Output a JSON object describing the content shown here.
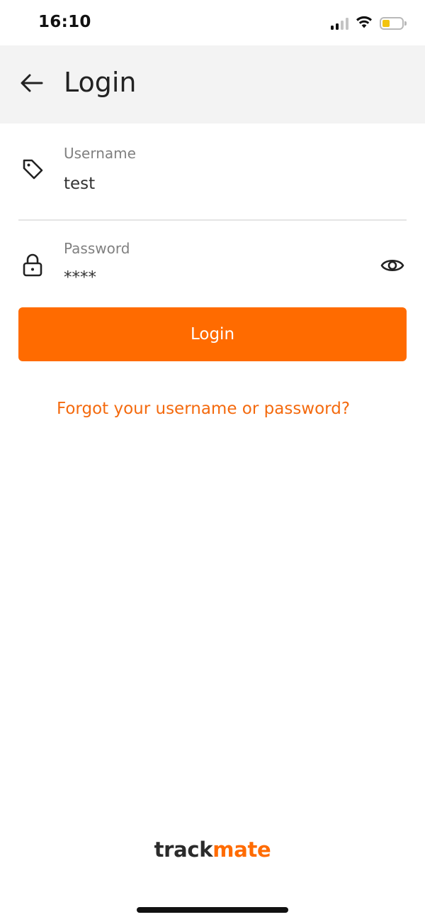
{
  "status_bar": {
    "time": "16:10",
    "signal_bars": 4,
    "signal_active_bars": 2,
    "battery_level": 0.2,
    "battery_color": "#f2c40f"
  },
  "header": {
    "title": "Login",
    "back_icon": "arrow-left-icon",
    "background": "#f3f3f3"
  },
  "form": {
    "username": {
      "label": "Username",
      "value": "test",
      "icon": "tag-icon"
    },
    "password": {
      "label": "Password",
      "value": "****",
      "icon": "lock-icon",
      "toggle_icon": "eye-icon"
    },
    "submit_label": "Login",
    "forgot_link": "Forgot your username or password?"
  },
  "footer": {
    "logo_part1": "track",
    "logo_part2": "mate"
  },
  "colors": {
    "accent": "#ff6b00",
    "link": "#f46a0e",
    "text": "#222222",
    "label": "#808080"
  }
}
